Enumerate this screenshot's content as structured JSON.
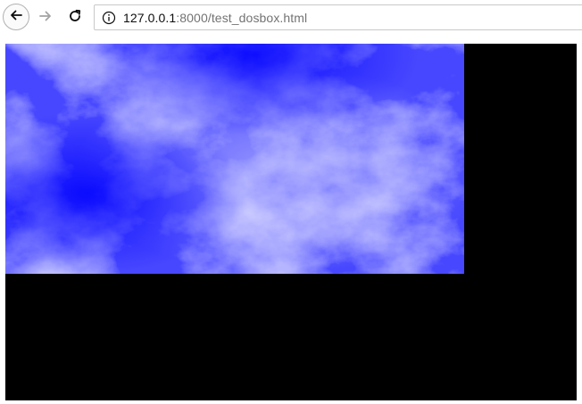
{
  "browser": {
    "url_host": "127.0.0.1",
    "url_rest": ":8000/test_dosbox.html",
    "icons": {
      "back": "back-arrow-icon",
      "forward": "forward-arrow-icon",
      "reload": "reload-icon",
      "info": "info-icon"
    }
  },
  "colors": {
    "sky_deep": "#0000ff",
    "sky_mid": "#5a5aff",
    "cloud": "#e6e6ff",
    "viewport_bg": "#000000"
  }
}
